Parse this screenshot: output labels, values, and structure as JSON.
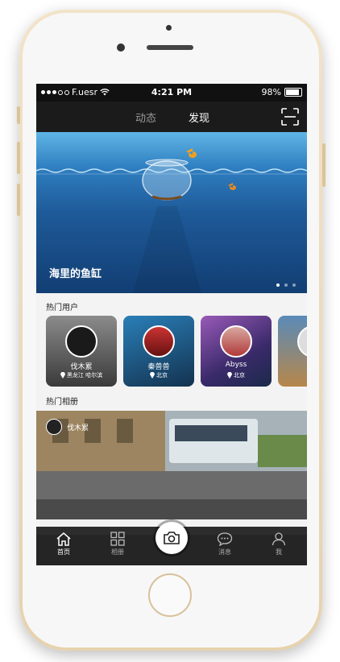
{
  "status": {
    "carrier": "F.uesr",
    "time": "4:21 PM",
    "battery": "98%"
  },
  "nav": {
    "tabs": [
      {
        "label": "动态",
        "active": false
      },
      {
        "label": "发现",
        "active": true
      }
    ],
    "scan_icon": "scan-icon"
  },
  "banner": {
    "title": "海里的鱼缸",
    "pages": 3,
    "current_page": 1
  },
  "hot_users": {
    "title": "热门用户",
    "users": [
      {
        "name": "伐木累",
        "location": "黑龙江 哈尔滨"
      },
      {
        "name": "秦兽兽",
        "location": "北京"
      },
      {
        "name": "Abyss",
        "location": "北京"
      }
    ]
  },
  "hot_albums": {
    "title": "热门相册",
    "items": [
      {
        "user": "伐木累"
      }
    ]
  },
  "tabbar": {
    "items": [
      {
        "label": "首页",
        "icon": "home-icon",
        "active": true
      },
      {
        "label": "相册",
        "icon": "grid-icon",
        "active": false
      },
      {
        "label": "消息",
        "icon": "chat-icon",
        "active": false
      },
      {
        "label": "我",
        "icon": "user-icon",
        "active": false
      }
    ],
    "camera_icon": "camera-icon"
  },
  "colors": {
    "accent": "#ffffff",
    "navbar": "#1b1b1b",
    "tabbar": "#262626",
    "background": "#f3f3f3"
  }
}
